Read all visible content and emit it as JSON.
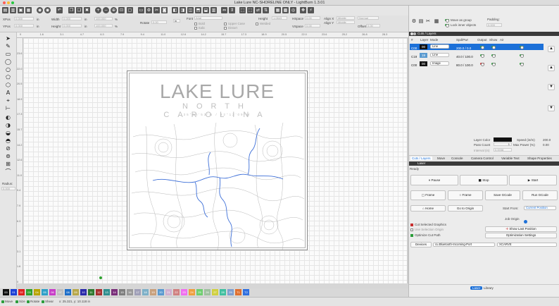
{
  "window": {
    "title": "Lake Lure NC-SHORELINE ONLY - LightBurn 1.3.01"
  },
  "toolbar2": {
    "xpos": "XPos",
    "ypos": "YPos",
    "xpos_val": "0.000",
    "ypos_val": "0.000",
    "width": "Width",
    "height": "Height",
    "width_val": "0.000",
    "height_val": "0.000",
    "unit": "in",
    "pct": "100.000",
    "pct_sign": "%",
    "rotate": "Rotate",
    "rotate_val": "0.00",
    "font": "Font",
    "font_val": "Arial",
    "bold": "Bold",
    "italic": "Italic",
    "upper_case": "Upper Case",
    "welded": "Welded",
    "distort": "Distort",
    "offset_label": "Offset",
    "height_label": "Height",
    "height_font": "1.0843",
    "hspace": "HSpace",
    "vspace": "VSpace",
    "hspace_val": "0.00",
    "vspace_val": "0.00",
    "alignx": "Align X",
    "aligny": "Align Y",
    "alignx_val": "Middle",
    "aligny_val": "Middle",
    "normal": "Normal",
    "offset": "Offset",
    "offset_val": "0.00"
  },
  "left_tools": {
    "radius_label": "Radius:",
    "radius_val": "0.000"
  },
  "ruler_h": [
    "0",
    "1.6",
    "3.1",
    "4.7",
    "6.3",
    "7.9",
    "9.4",
    "11.0",
    "12.6",
    "14.2",
    "15.7",
    "17.3",
    "18.9",
    "20.5",
    "22.0",
    "23.6",
    "25.2",
    "26.8",
    "28.3"
  ],
  "ruler_v": [
    "23.6",
    "22.0",
    "20.5",
    "18.9",
    "17.3",
    "15.7",
    "14.2",
    "12.6",
    "11.0",
    "9.4",
    "7.9",
    "6.3",
    "4.7",
    "3.1",
    "1.6",
    "0"
  ],
  "design": {
    "title": "LAKE LURE",
    "subtitle": "NORTH CAROLINA",
    "coords": "35°25'53\"N / 82°12'09\"W"
  },
  "palette": [
    {
      "label": "00",
      "color": "#111111"
    },
    {
      "label": "01",
      "color": "#1b3fd6"
    },
    {
      "label": "02",
      "color": "#e02020"
    },
    {
      "label": "03",
      "color": "#2fa12f"
    },
    {
      "label": "04",
      "color": "#b8a400"
    },
    {
      "label": "05",
      "color": "#2ea0c8"
    },
    {
      "label": "06",
      "color": "#c83ec8"
    },
    {
      "label": "07",
      "color": "#c0c0c0"
    },
    {
      "label": "08",
      "color": "#1f6fc9"
    },
    {
      "label": "09",
      "color": "#b8a84a"
    },
    {
      "label": "10",
      "color": "#2a2aaa"
    },
    {
      "label": "11",
      "color": "#2f7a2f"
    },
    {
      "label": "12",
      "color": "#a83030"
    },
    {
      "label": "13",
      "color": "#2f8f8f"
    },
    {
      "label": "14",
      "color": "#7a2f7a"
    },
    {
      "label": "15",
      "color": "#7f7f7f"
    },
    {
      "label": "16",
      "color": "#9a9a9a"
    },
    {
      "label": "17",
      "color": "#a0a0b8"
    },
    {
      "label": "18",
      "color": "#7db0c8"
    },
    {
      "label": "19",
      "color": "#c8a07d"
    },
    {
      "label": "20",
      "color": "#5a9ad0"
    },
    {
      "label": "21",
      "color": "#d0b0d0"
    },
    {
      "label": "22",
      "color": "#d08080"
    },
    {
      "label": "23",
      "color": "#ef6fef"
    },
    {
      "label": "24",
      "color": "#ef9f3f"
    },
    {
      "label": "25",
      "color": "#6fcf6f"
    },
    {
      "label": "26",
      "color": "#a0c0a0"
    },
    {
      "label": "27",
      "color": "#d0d040"
    },
    {
      "label": "28",
      "color": "#40c0a0"
    },
    {
      "label": "29",
      "color": "#80a0d0"
    },
    {
      "label": "T1",
      "color": "#e07030"
    },
    {
      "label": "T2",
      "color": "#3070e0"
    }
  ],
  "status": {
    "move": "Move",
    "size": "Size",
    "rotate": "Rotate",
    "shear": "Shear",
    "coords": "x: 25.321, y: 10.118 in"
  },
  "cuts": {
    "header": "Cuts / Layers",
    "cols": [
      "#",
      "Layer",
      "Mode",
      "Spd/Pwr",
      "Output",
      "Show",
      "Air"
    ],
    "rows": [
      {
        "num": "C00",
        "layer": "00",
        "mode": "Line",
        "spd": "200.0 / 0.0",
        "color": "#111111",
        "selected": true
      },
      {
        "num": "C19",
        "layer": "19",
        "mode": "Line",
        "spd": "40.0 / 100.0",
        "color": "#5a9ad0",
        "selected": false
      },
      {
        "num": "C00",
        "layer": "00",
        "mode": "Image",
        "spd": "80.0 / 100.0",
        "color": "#111111",
        "selected": false
      }
    ],
    "move_as_group": "Move as group",
    "lock_inner": "Lock inner objects",
    "padding": "Padding:",
    "padding_val": "0.000",
    "layer_color": "Layer Color",
    "speed": "Speed (in/m)",
    "speed_val": "200.0",
    "pass_count": "Pass Count",
    "pass_val": "1",
    "max_power": "Max Power (%)",
    "max_val": "0.00",
    "interval": "Interval (in)",
    "interval_val": "0.0038"
  },
  "tabs1": [
    "Cuts / Layers",
    "Move",
    "Console",
    "Camera Control",
    "Variable Text",
    "Shape Properties"
  ],
  "laser": {
    "header": "Laser",
    "ready": "Ready",
    "pause": "Pause",
    "stop": "Stop",
    "start": "Start",
    "frame1": "Frame",
    "frame2": "Frame",
    "save_gcode": "Save GCode",
    "run_gcode": "Run GCode",
    "home": "Home",
    "go_origin": "Go to Origin",
    "start_from": "Start From:",
    "start_from_val": "Current Position",
    "job_origin": "Job Origin",
    "cut_selected": "Cut Selected Graphics",
    "use_selection": "Use Selection Origin",
    "show_last": "Show Last Position",
    "optimize_cut": "Optimize Cut Path",
    "optimization": "Optimization Settings",
    "devices": "Devices",
    "port": "cu.Bluetooth-Incoming-Port",
    "machine": "XCARVE"
  },
  "tabs2": [
    "Laser",
    "Library"
  ],
  "colors": {
    "accent": "#1c70d8",
    "selected_row": "#1c70d8"
  }
}
